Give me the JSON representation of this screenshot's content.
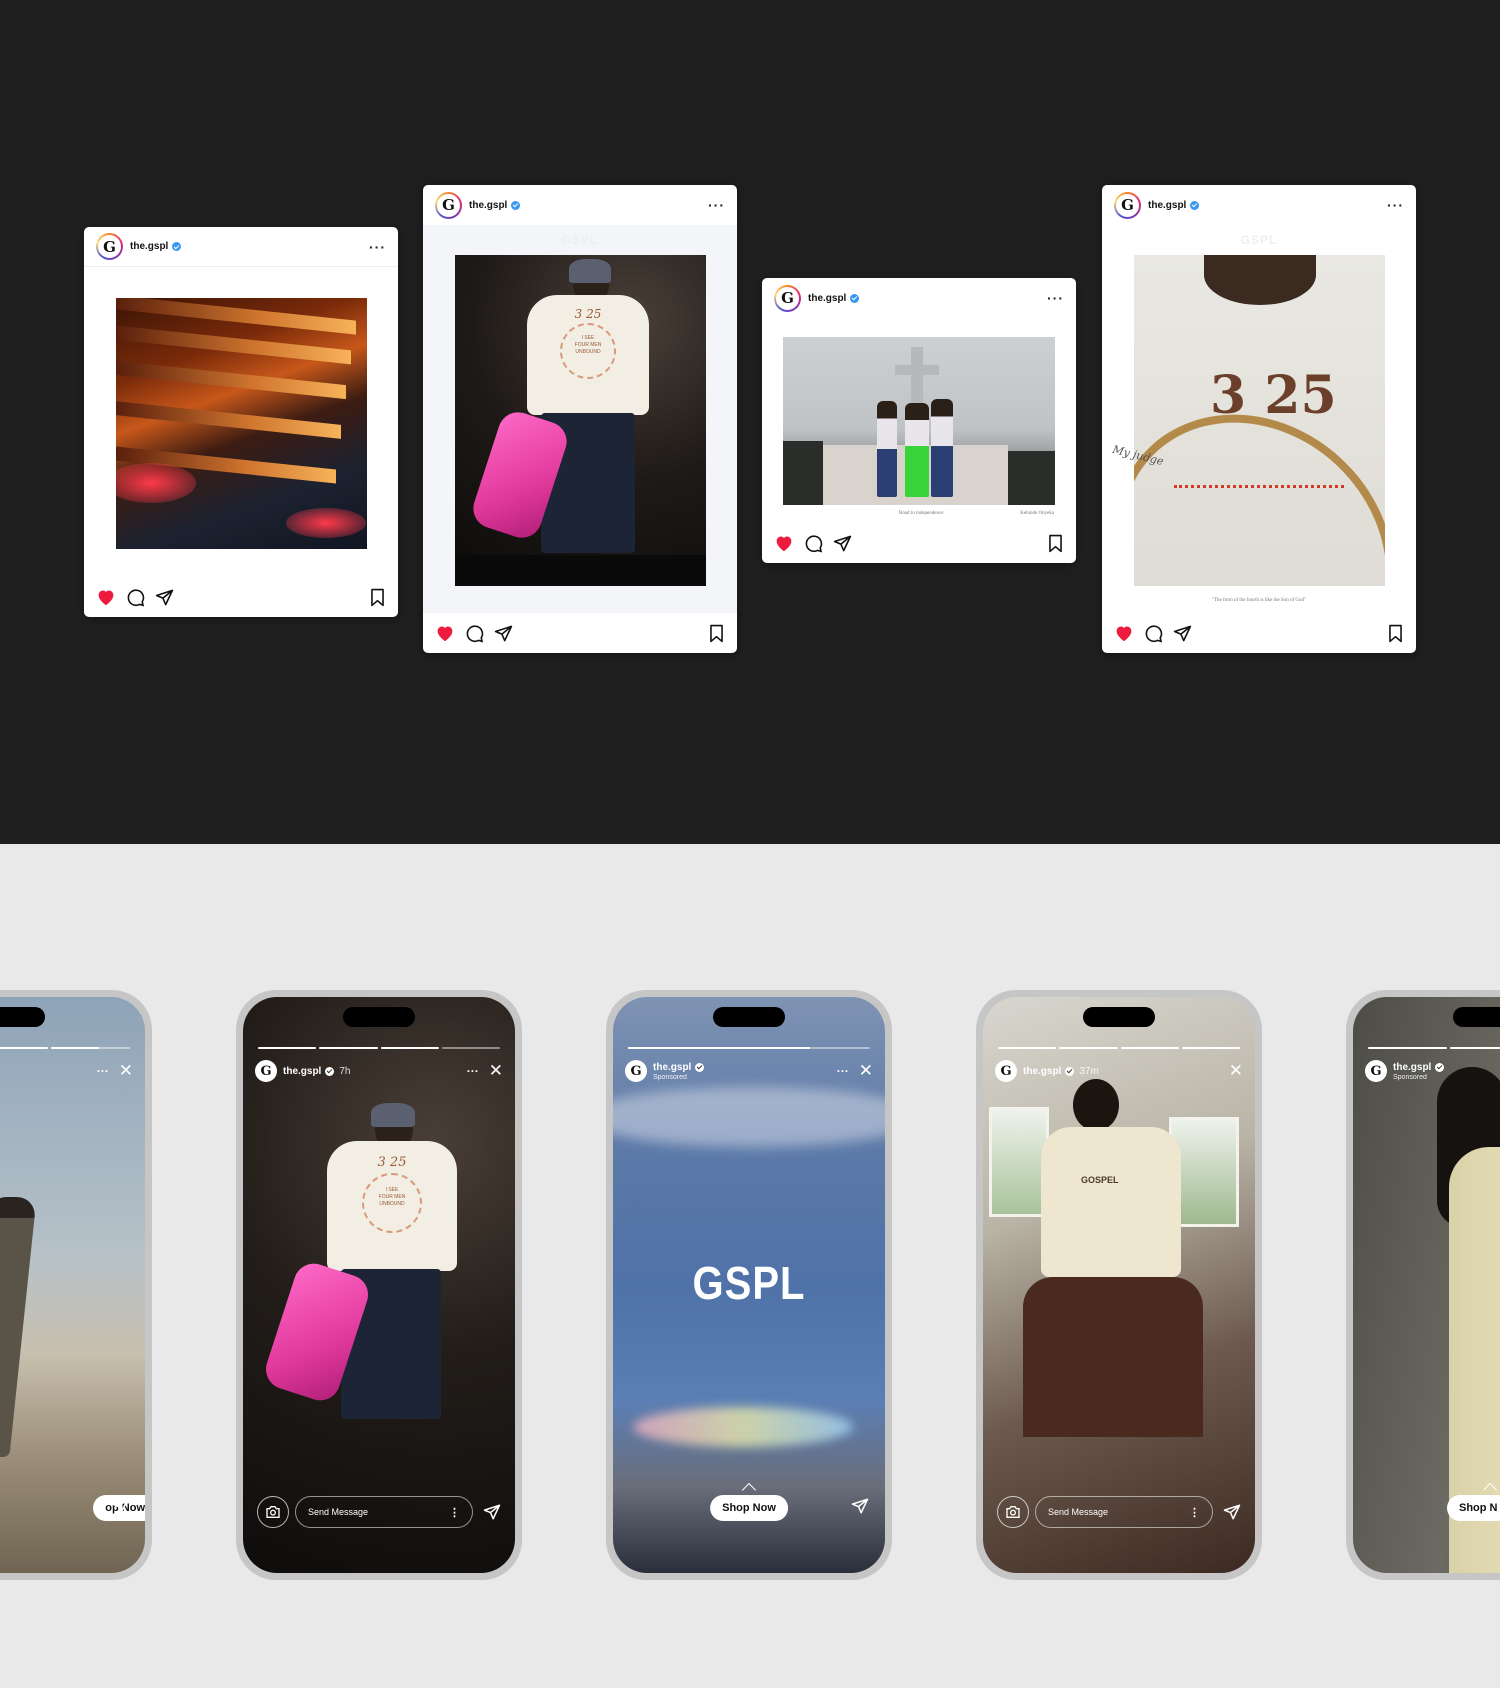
{
  "posts": [
    {
      "handle": "the.gspl",
      "avatar_letter": "G",
      "menu": "···",
      "liked": true
    },
    {
      "handle": "the.gspl",
      "avatar_letter": "G",
      "menu": "···",
      "liked": true,
      "watermark": "GSPL",
      "shirt_number": "3 25",
      "shirt_line1": "I SEE",
      "shirt_line2": "FOUR MEN",
      "shirt_line3": "UNBOUND"
    },
    {
      "handle": "the.gspl",
      "avatar_letter": "G",
      "menu": "···",
      "liked": true,
      "caption_left": "Road to independence",
      "caption_right": "Kehinde Onyeka"
    },
    {
      "handle": "the.gspl",
      "avatar_letter": "G",
      "menu": "···",
      "liked": true,
      "watermark": "GSPL",
      "tee_number": "3 25",
      "script_text": "My judge",
      "caption": "\"The form of the fourth is like the Son of God\""
    }
  ],
  "stories": [
    {
      "handle": "",
      "time": "",
      "sponsored": "",
      "menu": "···",
      "cta": "op Now",
      "progress": [
        1,
        1,
        0.6
      ]
    },
    {
      "handle": "the.gspl",
      "avatar_letter": "G",
      "time": "7h",
      "menu": "···",
      "message_placeholder": "Send Message",
      "progress": [
        1,
        1,
        1,
        0.0
      ],
      "shirt_number": "3 25",
      "shirt_line1": "I SEE",
      "shirt_line2": "FOUR MEN",
      "shirt_line3": "UNBOUND"
    },
    {
      "handle": "the.gspl",
      "avatar_letter": "G",
      "sponsored": "Sponsored",
      "menu": "···",
      "brand": "GSPL",
      "cta": "Shop Now",
      "progress": [
        0.75
      ]
    },
    {
      "handle": "the.gspl",
      "avatar_letter": "G",
      "time": "37m",
      "message_placeholder": "Send Message",
      "progress": [
        1,
        1,
        1,
        1
      ],
      "shirt_text": "GOSPEL"
    },
    {
      "handle": "the.gspl",
      "avatar_letter": "G",
      "sponsored": "Sponsored",
      "cta": "Shop N",
      "progress": [
        1,
        1,
        1
      ]
    }
  ],
  "colors": {
    "dark_bg": "#1f1f1f",
    "light_bg": "#e9e9e9",
    "like": "#ed1c3e",
    "verified": "#3897f0",
    "phone_frame": "#c6c6c6"
  },
  "icons": [
    "heart-icon",
    "comment-icon",
    "share-icon",
    "bookmark-icon",
    "verified-icon",
    "camera-icon",
    "close-icon",
    "chevron-up-icon",
    "send-icon"
  ]
}
